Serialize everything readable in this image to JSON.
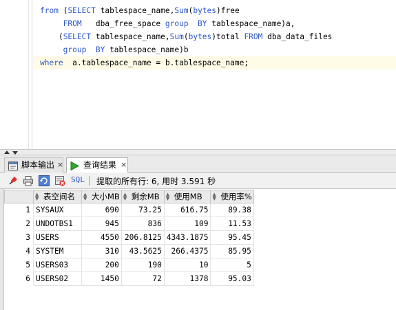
{
  "editor": {
    "lines": [
      {
        "tokens": [
          {
            "t": "from ",
            "c": "kw"
          },
          {
            "t": "(",
            "c": ""
          },
          {
            "t": "SELECT",
            "c": "kw"
          },
          {
            "t": " tablespace_name,",
            "c": ""
          },
          {
            "t": "Sum",
            "c": "fn"
          },
          {
            "t": "(",
            "c": ""
          },
          {
            "t": "bytes",
            "c": "kw"
          },
          {
            "t": ")free",
            "c": ""
          }
        ]
      },
      {
        "tokens": [
          {
            "t": "     FROM",
            "c": "kw"
          },
          {
            "t": "   dba_free_space ",
            "c": ""
          },
          {
            "t": "group",
            "c": "kw"
          },
          {
            "t": "  ",
            "c": ""
          },
          {
            "t": "BY",
            "c": "kw"
          },
          {
            "t": " tablespace_name)a,",
            "c": ""
          }
        ]
      },
      {
        "tokens": [
          {
            "t": "    (",
            "c": ""
          },
          {
            "t": "SELECT",
            "c": "kw"
          },
          {
            "t": " tablespace_name,",
            "c": ""
          },
          {
            "t": "Sum",
            "c": "fn"
          },
          {
            "t": "(",
            "c": ""
          },
          {
            "t": "bytes",
            "c": "kw"
          },
          {
            "t": ")total ",
            "c": ""
          },
          {
            "t": "FROM",
            "c": "kw"
          },
          {
            "t": " dba_data_files",
            "c": ""
          }
        ]
      },
      {
        "tokens": [
          {
            "t": "     group",
            "c": "kw"
          },
          {
            "t": "  ",
            "c": ""
          },
          {
            "t": "BY",
            "c": "kw"
          },
          {
            "t": " tablespace_name)b",
            "c": ""
          }
        ]
      },
      {
        "tokens": [
          {
            "t": "where",
            "c": "kw"
          },
          {
            "t": "  a.tablespace_name = b.tablespace_name;",
            "c": ""
          }
        ]
      }
    ]
  },
  "tabs": [
    {
      "label": "脚本输出",
      "close": "×"
    },
    {
      "label": "查询结果",
      "close": "×"
    }
  ],
  "toolbar": {
    "sql_label": "SQL",
    "status": "提取的所有行: 6, 用时 3.591 秒"
  },
  "grid": {
    "columns": [
      "表空间名",
      "大小MB",
      "剩余MB",
      "使用MB",
      "使用率%"
    ],
    "rows": [
      {
        "n": "1",
        "cells": [
          "SYSAUX",
          "690",
          "73.25",
          "616.75",
          "89.38"
        ]
      },
      {
        "n": "2",
        "cells": [
          "UNDOTBS1",
          "945",
          "836",
          "109",
          "11.53"
        ]
      },
      {
        "n": "3",
        "cells": [
          "USERS",
          "4550",
          "206.8125",
          "4343.1875",
          "95.45"
        ]
      },
      {
        "n": "4",
        "cells": [
          "SYSTEM",
          "310",
          "43.5625",
          "266.4375",
          "85.95"
        ]
      },
      {
        "n": "5",
        "cells": [
          "USERS03",
          "200",
          "190",
          "10",
          "5"
        ]
      },
      {
        "n": "6",
        "cells": [
          "USERS02",
          "1450",
          "72",
          "1378",
          "95.03"
        ]
      }
    ]
  },
  "colors": {
    "keyword": "#2a57c4",
    "current_line": "#fffbe6"
  }
}
